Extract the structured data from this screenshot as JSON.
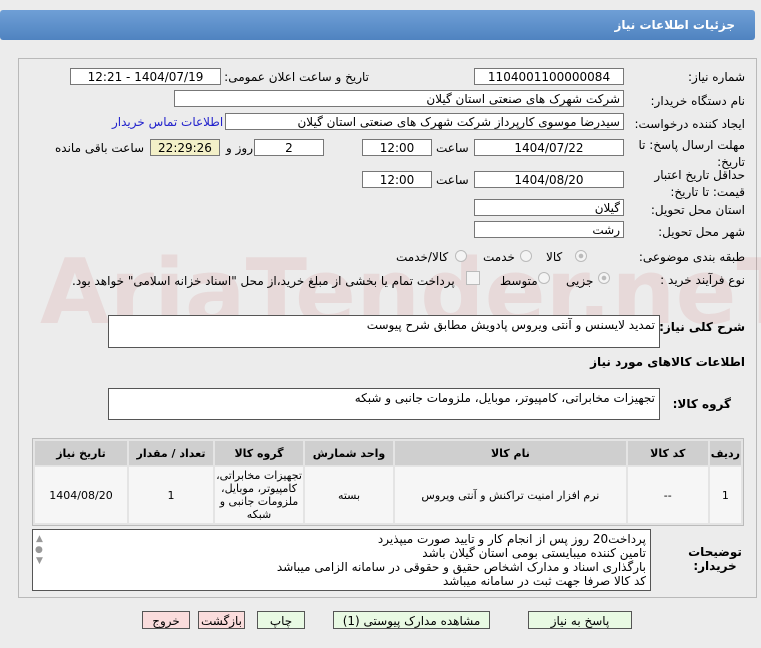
{
  "header": {
    "title": "جزئیات اطلاعات نیاز"
  },
  "watermark": "AriaTender.neT",
  "form": {
    "need_number_label": "شماره نیاز:",
    "need_number": "1104001100000084",
    "announce_label": "تاریخ و ساعت اعلان عمومی:",
    "announce_value": "1404/07/19 - 12:21",
    "buyer_label": "نام دستگاه خریدار:",
    "buyer": "شرکت شهرک های صنعتی استان گیلان",
    "creator_label": "ایجاد کننده درخواست:",
    "creator": "سیدرضا موسوی کارپرداز  شرکت شهرک های صنعتی استان گیلان",
    "contact_link": "اطلاعات تماس خریدار",
    "deadline_label": "مهلت ارسال پاسخ: تا تاریخ:",
    "deadline_date": "1404/07/22",
    "time_label": "ساعت",
    "deadline_time": "12:00",
    "days": "2",
    "days_label": "روز و",
    "remaining": "22:29:26",
    "remaining_label": "ساعت باقی مانده",
    "validity_label": "حداقل تاریخ اعتبار قیمت: تا تاریخ:",
    "validity_date": "1404/08/20",
    "validity_time": "12:00",
    "province_label": "استان محل تحویل:",
    "province": "گیلان",
    "city_label": "شهر محل تحویل:",
    "city": "رشت",
    "category_label": "طبقه بندی موضوعی:",
    "category_options": [
      "کالا",
      "خدمت",
      "کالا/خدمت"
    ],
    "category_selected": "کالا",
    "process_label": "نوع فرآیند خرید :",
    "process_options": [
      "جزیی",
      "متوسط"
    ],
    "process_selected": "جزیی",
    "treasury_text": "پرداخت تمام یا بخشی از مبلغ خرید،از محل \"اسناد خزانه اسلامی\" خواهد بود.",
    "desc_label": "شرح کلی نیاز:",
    "desc": "تمدید لایسنس و آنتی ویروس پادویش مطابق شرح پیوست",
    "goods_title": "اطلاعات کالاهای مورد نیاز",
    "group_label": "گروه کالا:",
    "group": "تجهیزات مخابراتی، کامپیوتر، موبایل، ملزومات جانبی و شبکه"
  },
  "table": {
    "headers": [
      "ردیف",
      "کد کالا",
      "نام کالا",
      "واحد شمارش",
      "گروه کالا",
      "تعداد / مقدار",
      "تاریخ نیاز"
    ],
    "rows": [
      [
        "1",
        "--",
        "نرم افزار امنیت تراکنش و آنتی ویروس",
        "بسته",
        "تجهیزات مخابراتی، کامپیوتر، موبایل، ملزومات جانبی و شبکه",
        "1",
        "1404/08/20"
      ]
    ]
  },
  "notes": {
    "label": "توضیحات خریدار:",
    "lines": [
      "پرداخت20 روز پس از انجام کار و تایید صورت میپذیرد",
      "تامین کننده میبایستی بومی استان گیلان باشد",
      "بارگذاری اسناد و مدارک اشخاص حقیق و حقوقی در سامانه الزامی میباشد",
      "کد کالا صرفا جهت ثبت در سامانه میباشد"
    ]
  },
  "buttons": {
    "reply": "پاسخ به نیاز",
    "attachments": "مشاهده مدارک پیوستی (1)",
    "print": "چاپ",
    "back": "بازگشت",
    "exit": "خروج"
  }
}
